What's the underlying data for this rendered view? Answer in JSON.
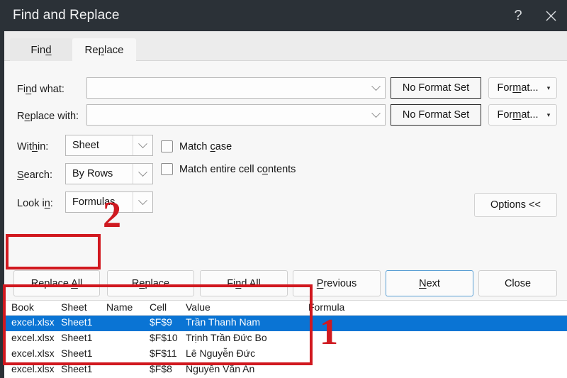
{
  "window": {
    "title": "Find and Replace",
    "help_icon": "question-mark-icon",
    "close_icon": "close-x-icon"
  },
  "tabs": [
    {
      "label": "Find",
      "active": false
    },
    {
      "label": "Replace",
      "active": true
    }
  ],
  "form": {
    "find_what": {
      "label": "Find what:",
      "value": "",
      "placeholder": ""
    },
    "replace_with": {
      "label": "Replace with:",
      "value": "",
      "placeholder": ""
    },
    "find_format_status": "No Format Set",
    "replace_format_status": "No Format Set",
    "find_format_button": "Format...",
    "replace_format_button": "Format...",
    "within": {
      "label": "Within:",
      "value": "Sheet"
    },
    "search": {
      "label": "Search:",
      "value": "By Rows"
    },
    "look_in": {
      "label": "Look in:",
      "value": "Formulas"
    },
    "match_case": {
      "label": "Match case",
      "checked": false
    },
    "match_entire": {
      "label": "Match entire cell contents",
      "checked": false
    },
    "options_button": "Options <<"
  },
  "actions": {
    "replace_all": "Replace All",
    "replace": "Replace",
    "find_all": "Find All",
    "previous": "Previous",
    "next": "Next",
    "close": "Close"
  },
  "results": {
    "columns": [
      "Book",
      "Sheet",
      "Name",
      "Cell",
      "Value",
      "Formula"
    ],
    "rows": [
      {
        "book": "excel.xlsx",
        "sheet": "Sheet1",
        "name": "",
        "cell": "$F$9",
        "value": "Trần  Thanh  Nam",
        "formula": "",
        "selected": true
      },
      {
        "book": "excel.xlsx",
        "sheet": "Sheet1",
        "name": "",
        "cell": "$F$10",
        "value": "Trịnh  Trần  Đức  Bo",
        "formula": "",
        "selected": false
      },
      {
        "book": "excel.xlsx",
        "sheet": "Sheet1",
        "name": "",
        "cell": "$F$11",
        "value": "Lê  Nguyễn  Đức",
        "formula": "",
        "selected": false
      },
      {
        "book": "excel.xlsx",
        "sheet": "Sheet1",
        "name": "",
        "cell": "$F$8",
        "value": "Nguyễn  Văn  An",
        "formula": "",
        "selected": false
      }
    ]
  },
  "annotations": {
    "marker_one": "1",
    "marker_two": "2",
    "highlight_color": "#d1181f"
  },
  "colors": {
    "titlebar_bg": "#2b3137",
    "selection_blue": "#0a74d4",
    "panel_bg": "#f7f7f7",
    "annotation_red": "#d1181f"
  }
}
